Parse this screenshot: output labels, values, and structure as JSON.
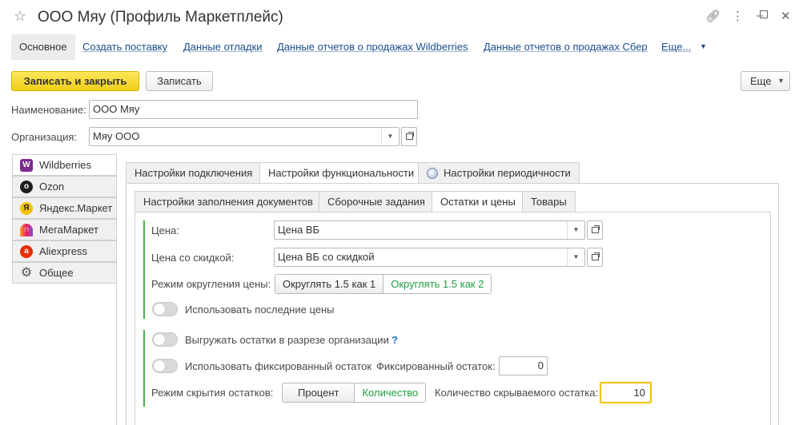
{
  "window": {
    "title": "ООО Мяу (Профиль Маркетплейс)"
  },
  "nav": {
    "items": [
      {
        "label": "Основное"
      },
      {
        "label": "Создать поставку"
      },
      {
        "label": "Данные отладки"
      },
      {
        "label": "Данные отчетов о продажах Wildberries"
      },
      {
        "label": "Данные отчетов о продажах Сбер"
      },
      {
        "label": "Еще..."
      }
    ]
  },
  "toolbar": {
    "save_close": "Записать и закрыть",
    "save": "Записать",
    "more": "Еще"
  },
  "form": {
    "name_label": "Наименование:",
    "name_value": "ООО Мяу",
    "org_label": "Организация:",
    "org_value": "Мяу ООО"
  },
  "marketplaces": [
    {
      "label": "Wildberries",
      "icon": "wildberries-icon",
      "color": "#7b2a8e"
    },
    {
      "label": "Ozon",
      "icon": "ozon-icon",
      "color": "#1f1f1f"
    },
    {
      "label": "Яндекс.Маркет",
      "icon": "yandex-market-icon",
      "color": "#f5c400"
    },
    {
      "label": "МегаМаркет",
      "icon": "megamarket-icon",
      "color": "#8a4fd1"
    },
    {
      "label": "Aliexpress",
      "icon": "aliexpress-icon",
      "color": "#e62e04"
    },
    {
      "label": "Общее",
      "icon": "gear-icon",
      "color": "#555555"
    }
  ],
  "settings_tabs": [
    {
      "label": "Настройки подключения"
    },
    {
      "label": "Настройки функциональности"
    },
    {
      "label": "Настройки периодичности"
    }
  ],
  "sub_tabs": [
    {
      "label": "Настройки заполнения документов"
    },
    {
      "label": "Сборочные задания"
    },
    {
      "label": "Остатки и цены"
    },
    {
      "label": "Товары"
    }
  ],
  "prices": {
    "price_label": "Цена:",
    "price_value": "Цена ВБ",
    "discount_label": "Цена со скидкой:",
    "discount_value": "Цена ВБ со скидкой",
    "rounding_label": "Режим округления цены:",
    "rounding_options": [
      "Округлять 1.5 как 1",
      "Округлять 1.5 как 2"
    ],
    "use_last_prices": "Использовать последние цены"
  },
  "stock": {
    "by_org": "Выгружать остатки в разрезе организации",
    "help": "?",
    "use_fixed": "Использовать фиксированный остаток",
    "fixed_label": "Фиксированный остаток:",
    "fixed_value": "0",
    "hide_mode_label": "Режим скрытия остатков:",
    "hide_mode_options": [
      "Процент",
      "Количество"
    ],
    "hidden_qty_label": "Количество скрываемого остатка:",
    "hidden_qty_value": "10"
  }
}
